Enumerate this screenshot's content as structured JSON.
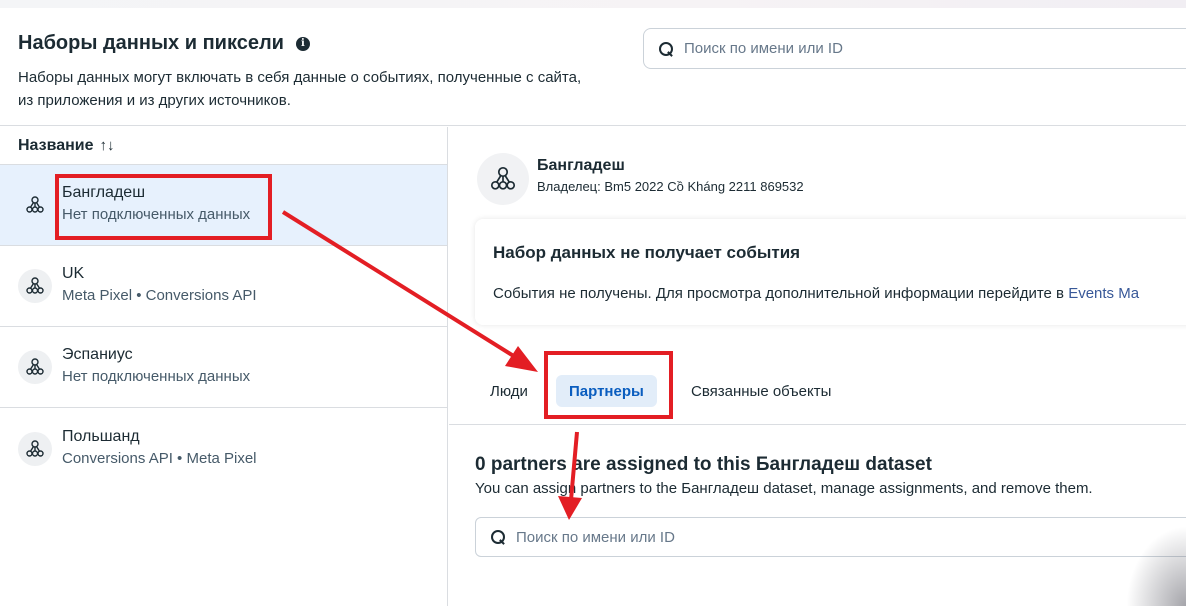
{
  "header": {
    "title": "Наборы данных и пиксели",
    "info_icon": "info-icon",
    "description": "Наборы данных могут включать в себя данные о событиях, полученные с сайта, из приложения и из других источников.",
    "search_placeholder": "Поиск по имени или ID"
  },
  "list": {
    "column_title": "Название",
    "sort_icon": "↑↓",
    "items": [
      {
        "name": "Бангладеш",
        "subtitle": "Нет подключенных данных",
        "selected": true
      },
      {
        "name": "UK",
        "subtitle": "Meta Pixel • Conversions API",
        "selected": false
      },
      {
        "name": "Эспаниус",
        "subtitle": "Нет подключенных данных",
        "selected": false
      },
      {
        "name": "Польшанд",
        "subtitle": "Conversions API • Meta Pixel",
        "selected": false
      }
    ]
  },
  "detail": {
    "name": "Бангладеш",
    "owner": "Владелец: Bm5 2022 Cồ Kháng 2211 869532",
    "status_title": "Набор данных не получает события",
    "status_text": "События не получены. Для просмотра дополнительной информации перейдите в ",
    "status_link": "Events Ma",
    "tabs": {
      "people": "Люди",
      "partners": "Партнеры",
      "related": "Связанные объекты"
    },
    "partners_title": "0 partners are assigned to this Бангладеш dataset",
    "partners_desc": "You can assign partners to the Бангладеш dataset, manage assignments, and remove them.",
    "search_placeholder": "Поиск по имени или ID"
  },
  "colors": {
    "annotation_red": "#e31e24",
    "selected_row": "#e7f1fd",
    "active_tab_bg": "#e2edf9",
    "active_tab_text": "#0a5dbf",
    "link": "#385898"
  }
}
